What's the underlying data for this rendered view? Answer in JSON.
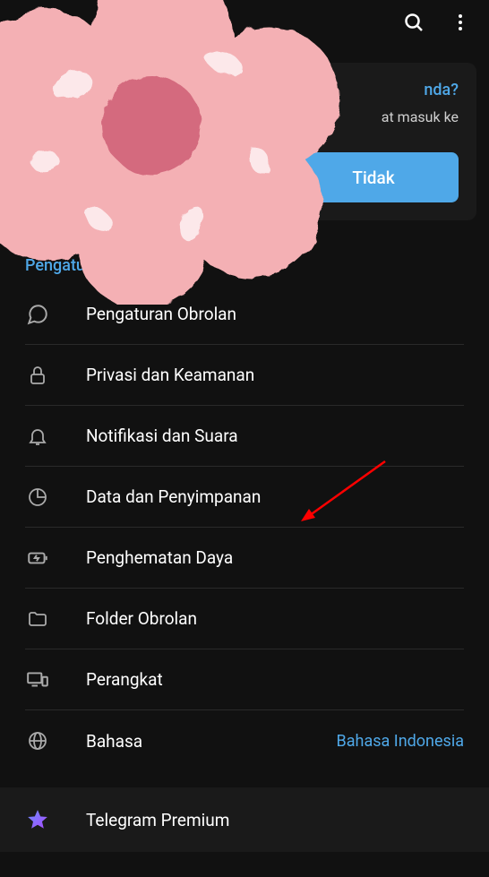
{
  "topbar": {
    "search_icon": "search-icon",
    "more_icon": "more-vertical-icon"
  },
  "banner": {
    "title_fragment": "nda?",
    "sub_fragment": "at masuk ke",
    "button_label": "Tidak"
  },
  "section_title": "Pengaturan",
  "settings": [
    {
      "icon": "chat-bubble-icon",
      "label": "Pengaturan Obrolan"
    },
    {
      "icon": "lock-icon",
      "label": "Privasi dan Keamanan"
    },
    {
      "icon": "bell-icon",
      "label": "Notifikasi dan Suara"
    },
    {
      "icon": "pie-chart-icon",
      "label": "Data dan Penyimpanan"
    },
    {
      "icon": "battery-icon",
      "label": "Penghematan Daya"
    },
    {
      "icon": "folder-icon",
      "label": "Folder Obrolan"
    },
    {
      "icon": "devices-icon",
      "label": "Perangkat"
    },
    {
      "icon": "globe-icon",
      "label": "Bahasa",
      "value": "Bahasa Indonesia"
    }
  ],
  "premium": {
    "label": "Telegram Premium"
  }
}
